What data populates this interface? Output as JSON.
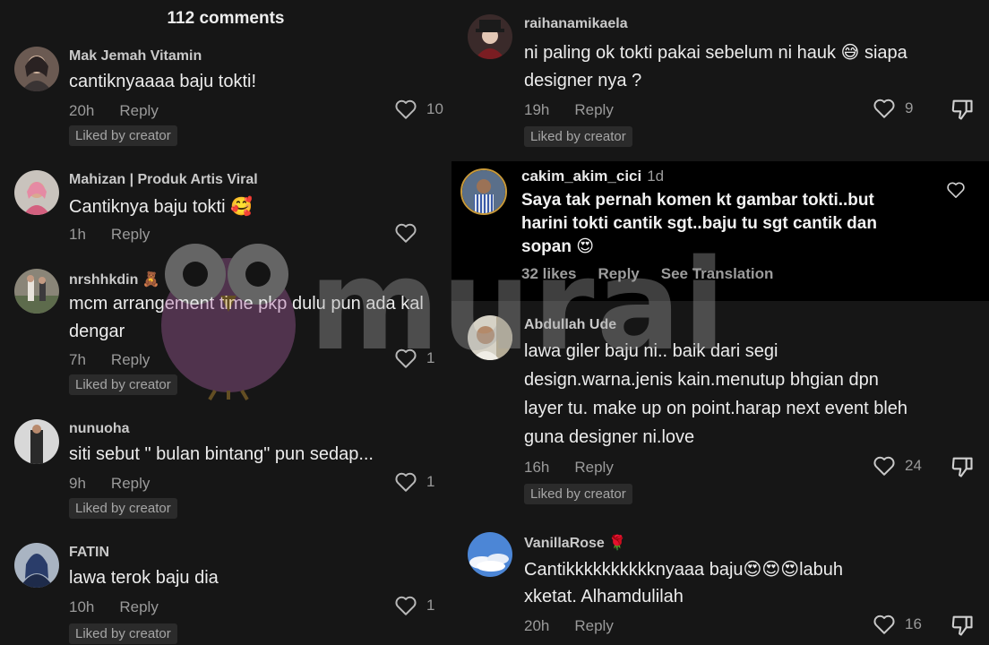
{
  "left": {
    "title": "112 comments",
    "comments": [
      {
        "user": "Mak Jemah Vitamin",
        "lines": [
          "cantiknyaaaa baju tokti!"
        ],
        "time": "20h",
        "reply": "Reply",
        "likes": "10",
        "badge": "Liked by creator"
      },
      {
        "user": "Mahizan | Produk Artis Viral",
        "lines": [
          "Cantiknya baju tokti 🥰"
        ],
        "time": "1h",
        "reply": "Reply",
        "likes": "",
        "badge": ""
      },
      {
        "user": "nrshhkdin 🧸",
        "lines": [
          "mcm arrangement time pkp dulu pun ada kal",
          "dengar"
        ],
        "time": "7h",
        "reply": "Reply",
        "likes": "1",
        "badge": "Liked by creator"
      },
      {
        "user": "nunuoha",
        "lines": [
          "siti sebut \" bulan bintang\" pun sedap..."
        ],
        "time": "9h",
        "reply": "Reply",
        "likes": "1",
        "badge": "Liked by creator"
      },
      {
        "user": "FATIN",
        "lines": [
          "lawa terok baju dia"
        ],
        "time": "10h",
        "reply": "Reply",
        "likes": "1",
        "badge": "Liked by creator"
      }
    ]
  },
  "right": {
    "comments": [
      {
        "user": "raihanamikaela",
        "lines": [
          "ni paling ok tokti pakai sebelum ni hauk 😅 siapa",
          "designer nya ?"
        ],
        "time": "19h",
        "reply": "Reply",
        "likes": "9",
        "badge": "Liked by creator"
      },
      {
        "user": "Abdullah Ude",
        "lines": [
          "lawa giler baju ni.. baik dari segi",
          "design.warna.jenis kain.menutup bhgian dpn",
          "layer tu. make up on point.harap next event bleh",
          "guna designer ni.love"
        ],
        "time": "16h",
        "reply": "Reply",
        "likes": "24",
        "badge": "Liked by creator"
      },
      {
        "user": "VanillaRose 🌹",
        "lines": [
          "Cantikkkkkkkkkknyaaa baju😍😍😍labuh",
          "xketat. Alhamdulilah"
        ],
        "time": "20h",
        "reply": "Reply",
        "likes": "16",
        "badge": ""
      }
    ],
    "highlight": {
      "user": "cakim_akim_cici",
      "time": "1d",
      "lines": [
        "Saya tak pernah komen kt gambar tokti..but",
        "harini tokti cantik sgt..baju tu sgt cantik dan",
        "sopan 😍"
      ],
      "likes": "32 likes",
      "reply": "Reply",
      "translate": "See Translation"
    }
  },
  "watermark": {
    "text": "murai"
  },
  "colors": {
    "background": "#161616",
    "highlight_bg": "#000000",
    "badge_bg": "#2b2b2b",
    "text": "#ececec",
    "muted": "#9a9a9a"
  }
}
